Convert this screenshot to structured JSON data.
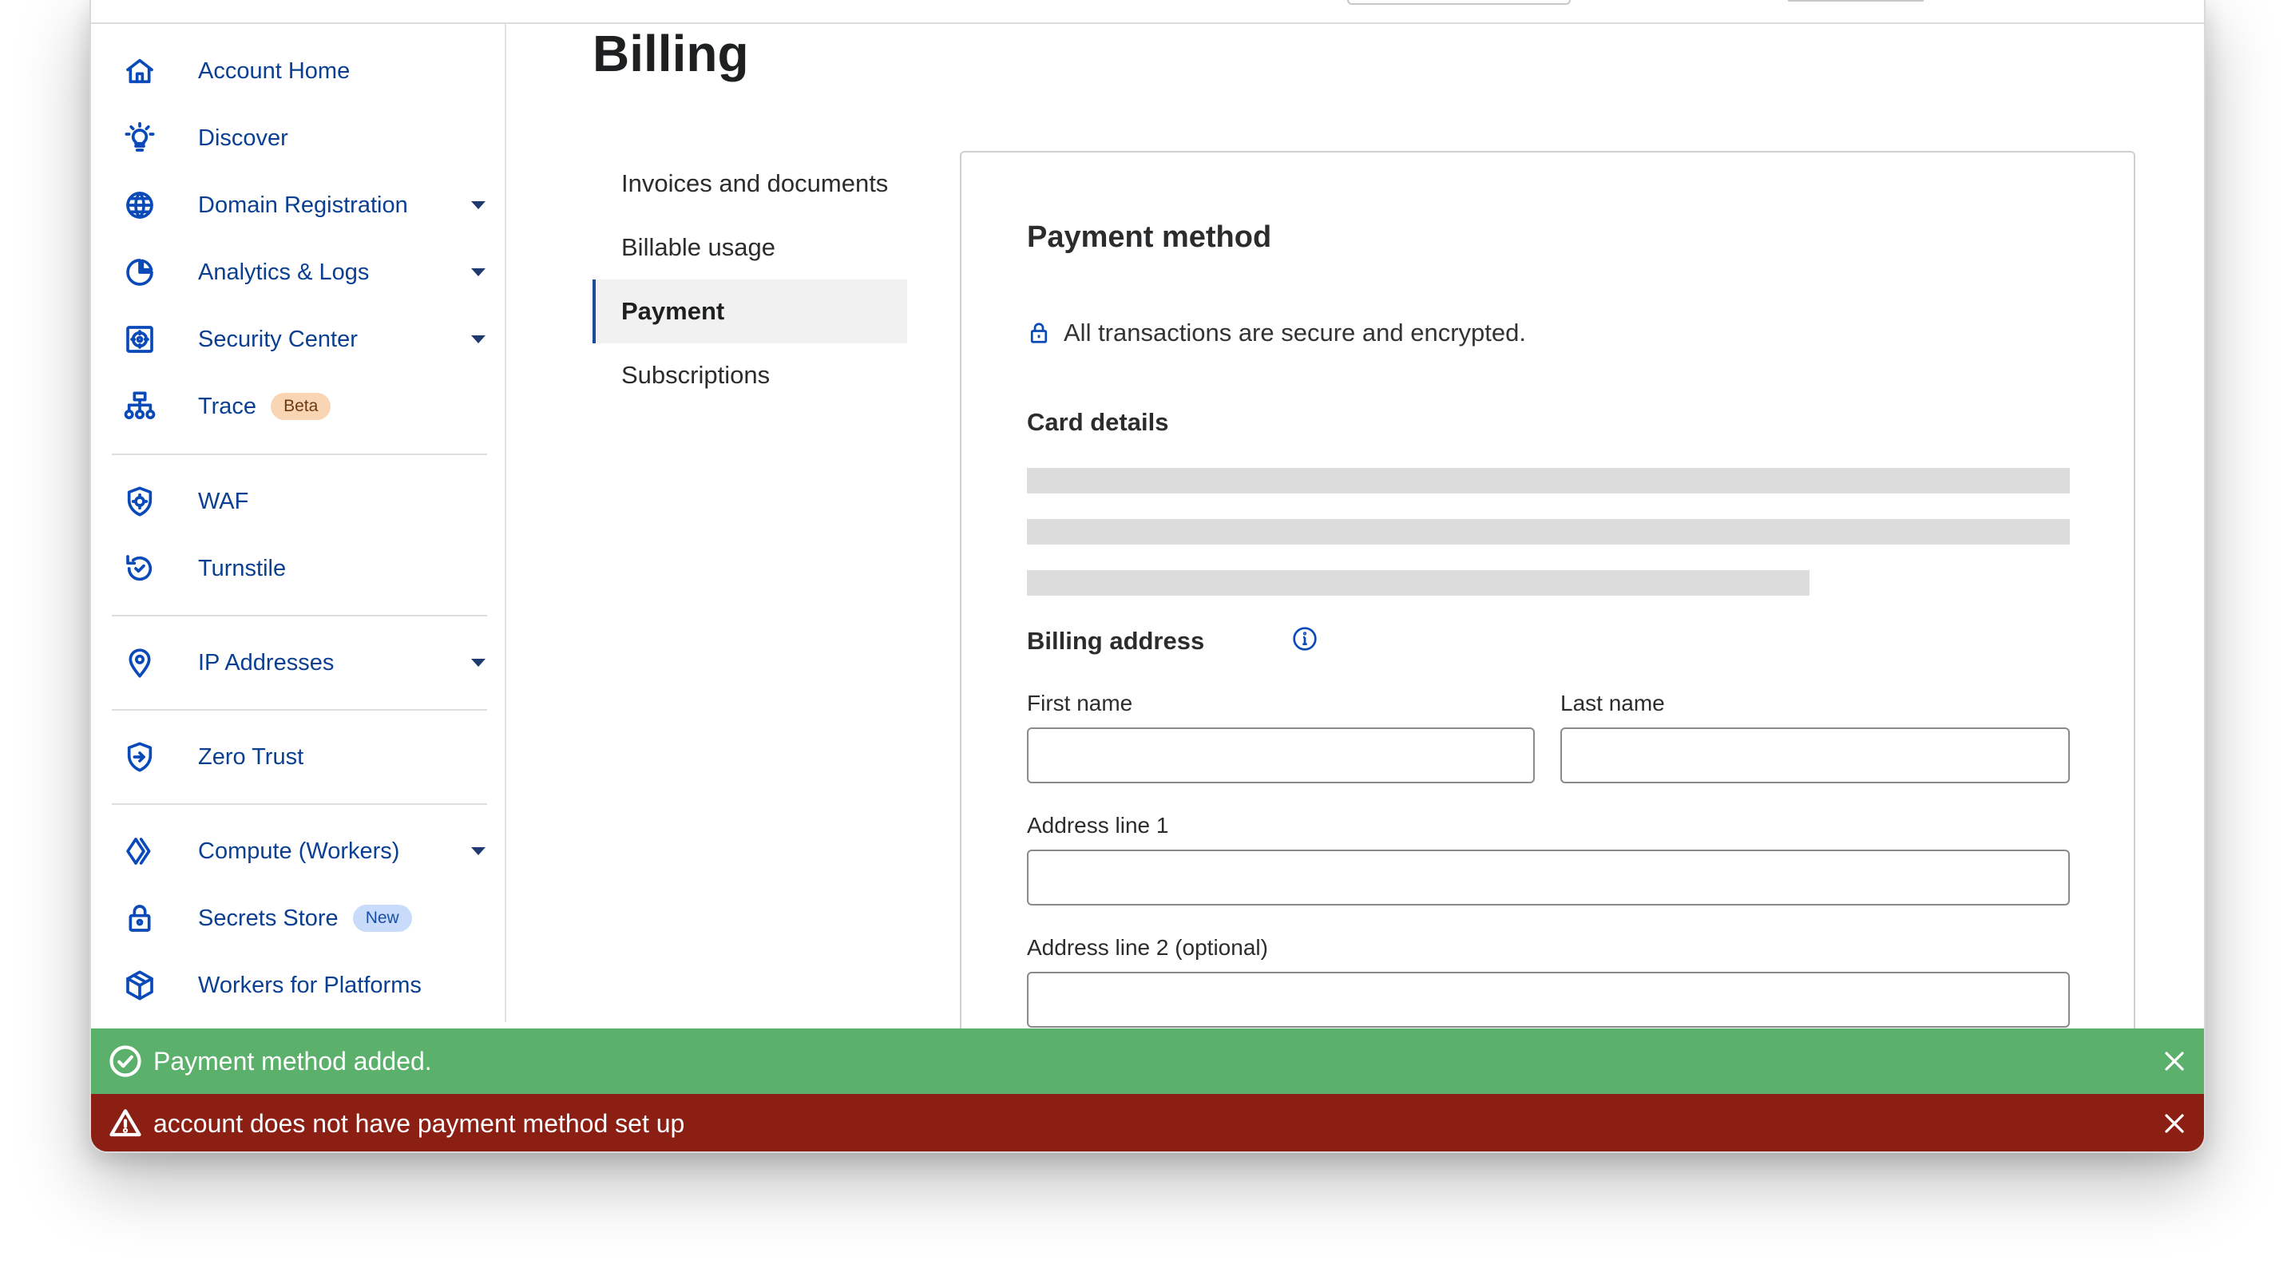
{
  "sidebar": {
    "items": [
      {
        "label": "Account Home",
        "icon": "home-icon"
      },
      {
        "label": "Discover",
        "icon": "lightbulb-icon"
      },
      {
        "label": "Domain Registration",
        "icon": "globe-icon",
        "expandable": true
      },
      {
        "label": "Analytics & Logs",
        "icon": "pie-chart-icon",
        "expandable": true
      },
      {
        "label": "Security Center",
        "icon": "security-center-icon",
        "expandable": true
      },
      {
        "label": "Trace",
        "icon": "trace-icon",
        "badge": "Beta"
      },
      {
        "label": "WAF",
        "icon": "waf-shield-icon"
      },
      {
        "label": "Turnstile",
        "icon": "turnstile-icon"
      },
      {
        "label": "IP Addresses",
        "icon": "location-pin-icon",
        "expandable": true
      },
      {
        "label": "Zero Trust",
        "icon": "zero-trust-icon"
      },
      {
        "label": "Compute (Workers)",
        "icon": "workers-icon",
        "expandable": true
      },
      {
        "label": "Secrets Store",
        "icon": "lock-icon",
        "badge": "New"
      },
      {
        "label": "Workers for Platforms",
        "icon": "cube-icon"
      }
    ]
  },
  "page": {
    "title": "Billing"
  },
  "subnav": {
    "items": [
      {
        "label": "Invoices and documents",
        "active": false
      },
      {
        "label": "Billable usage",
        "active": false
      },
      {
        "label": "Payment",
        "active": true
      },
      {
        "label": "Subscriptions",
        "active": false
      }
    ]
  },
  "payment": {
    "title": "Payment method",
    "secure_text": "All transactions are secure and encrypted.",
    "card_details_title": "Card details",
    "billing_address_title": "Billing address",
    "fields": {
      "first_name_label": "First name",
      "first_name_value": "",
      "last_name_label": "Last name",
      "last_name_value": "",
      "address1_label": "Address line 1",
      "address1_value": "",
      "address2_label": "Address line 2 (optional)",
      "address2_value": ""
    }
  },
  "toasts": {
    "success": {
      "text": "Payment method added.",
      "color": "#5bb06b"
    },
    "error": {
      "text": "account does not have payment method set up",
      "color": "#8c1f14"
    }
  },
  "colors": {
    "accent": "#0a4ab8",
    "nav_text": "#0b3f91",
    "badge_beta": "#f9d5b3",
    "badge_new": "#c8dbfa"
  }
}
